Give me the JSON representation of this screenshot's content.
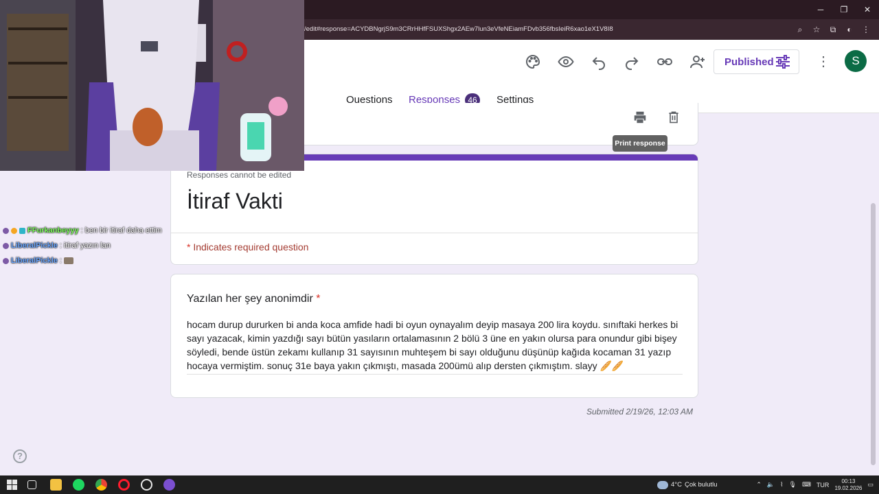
{
  "browser": {
    "url": "/edit#response=ACYDBNgrjS9m3CRrHHfFSUXShgx2AEw7lun3eVfeNEiamFDvb356fbsIeiR6xao1eX1V8I8"
  },
  "header": {
    "published_label": "Published",
    "avatar_letter": "S",
    "tabs": [
      {
        "label": "Questions"
      },
      {
        "label": "Responses"
      },
      {
        "label": "Settings"
      }
    ],
    "responses_count": "46"
  },
  "toolbar": {
    "print_tooltip": "Print response"
  },
  "form": {
    "cannot_edit": "Responses cannot be edited",
    "title": "İtiraf Vakti",
    "required_star": "*",
    "required_note": "Indicates required question"
  },
  "question": {
    "title": "Yazılan her şey anonimdir",
    "answer": "hocam durup dururken bi anda koca amfide hadi bi oyun oynayalım deyip masaya 200 lira koydu. sınıftaki herkes bi sayı yazacak, kimin yazdığı sayı bütün yasıların ortalamasının 2 bölü 3 üne en yakın olursa para onundur gibi bişey söyledi, bende üstün zekamı kullanıp 31 sayısının muhteşem bi sayı olduğunu düşünüp kağıda kocaman 31 yazıp hocaya vermiştim. sonuç 31e baya yakın çıkmıştı, masada 200ümü alıp dersten çıkmıştım. slayy 🥖🥖"
  },
  "submitted": "Submitted 2/19/26, 12:03 AM",
  "chat": [
    {
      "user": "FFurkanbeyyy",
      "message": ": ben bir itiraf daha ettim",
      "color": "#7cfc5a"
    },
    {
      "user": "LiberalPickle",
      "message": ": itiraf yazın lan",
      "color": "#6aa6ff"
    },
    {
      "user": "LiberalPickle",
      "message": ":",
      "color": "#6aa6ff"
    }
  ],
  "taskbar": {
    "weather_temp": "4°C",
    "weather_desc": "Çok bulutlu",
    "lang": "TUR",
    "time": "00:13",
    "date": "19.02.2026"
  },
  "colors": {
    "accent": "#673ab7",
    "page_bg": "#f0ebf8",
    "required": "#d93025"
  }
}
